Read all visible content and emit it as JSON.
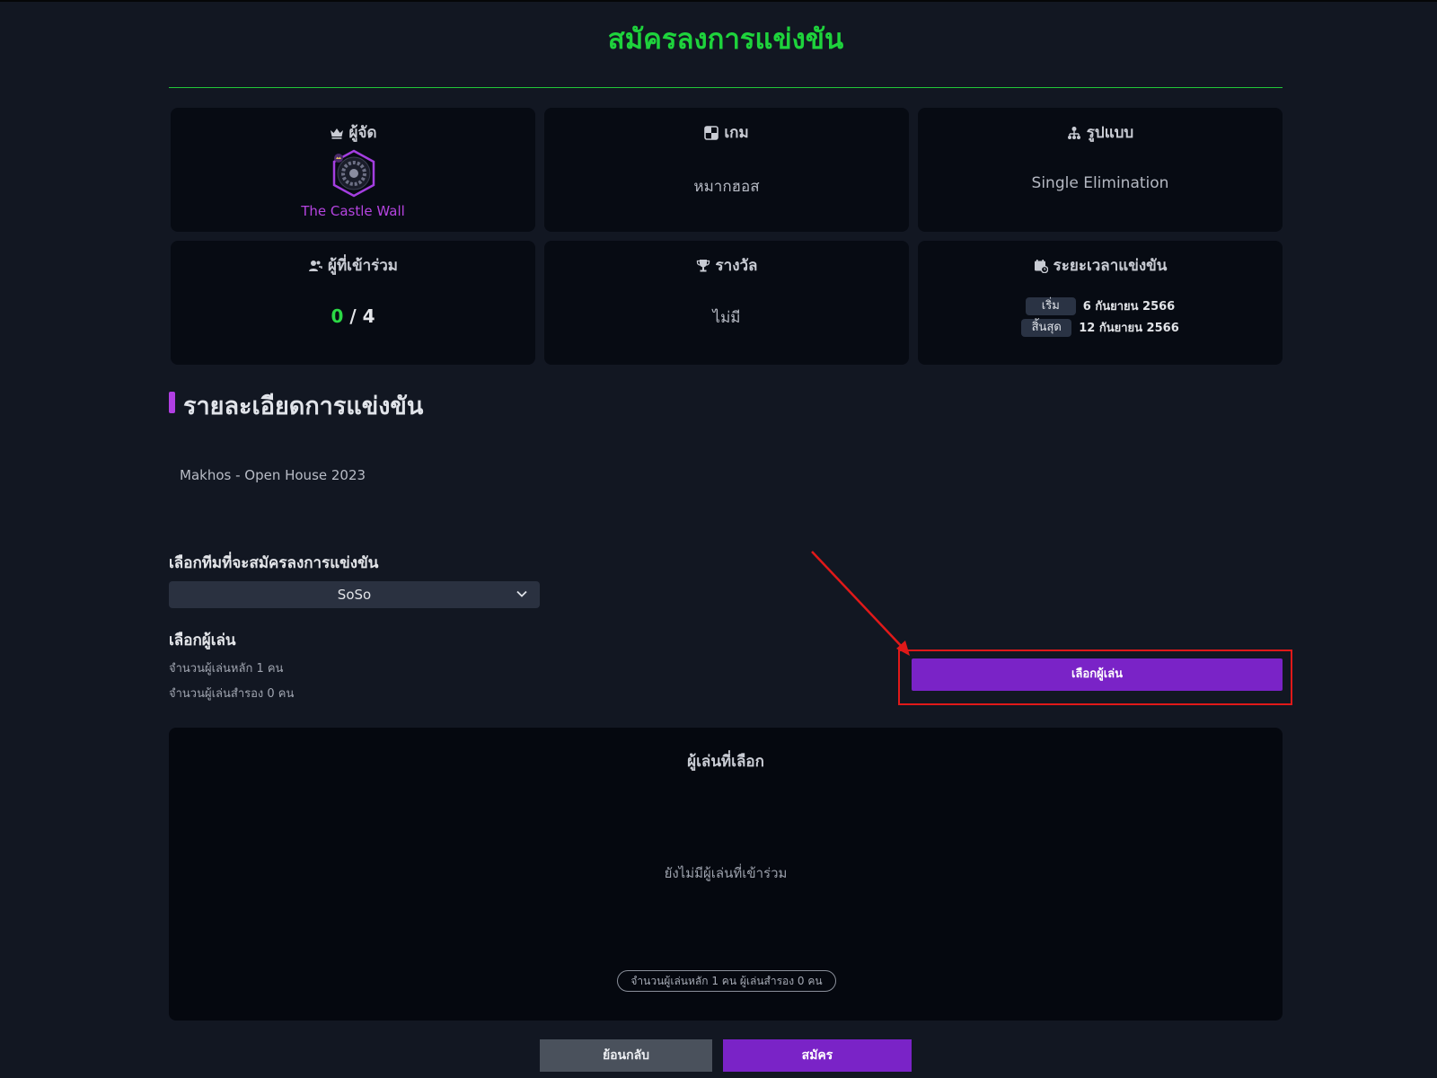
{
  "page": {
    "title": "สมัครลงการแข่งขัน"
  },
  "info_cards": {
    "organizer": {
      "label": "ผู้จัด",
      "name": "The Castle Wall"
    },
    "game": {
      "label": "เกม",
      "value": "หมากฮอส"
    },
    "format": {
      "label": "รูปแบบ",
      "value": "Single Elimination"
    },
    "participants": {
      "label": "ผู้ที่เข้าร่วม",
      "current": "0",
      "separator": " / ",
      "max": "4"
    },
    "prize": {
      "label": "รางวัล",
      "value": "ไม่มี"
    },
    "period": {
      "label": "ระยะเวลาแข่งขัน",
      "start_label": "เริ่ม",
      "start_date": "6 กันยายน 2566",
      "end_label": "สิ้นสุด",
      "end_date": "12 กันยายน 2566"
    }
  },
  "details": {
    "heading": "รายละเอียดการแข่งขัน",
    "description": "Makhos - Open House 2023"
  },
  "team_select": {
    "label": "เลือกทีมที่จะสมัครลงการแข่งขัน",
    "selected": "SoSo"
  },
  "players": {
    "label": "เลือกผู้เล่น",
    "main_count_text": "จำนวนผู้เล่นหลัก 1 คน",
    "sub_count_text": "จำนวนผู้เล่นสำรอง 0 คน",
    "pick_button": "เลือกผู้เล่น"
  },
  "selected_panel": {
    "title": "ผู้เล่นที่เลือก",
    "empty_text": "ยังไม่มีผู้เล่นที่เข้าร่วม",
    "summary_pill": "จำนวนผู้เล่นหลัก 1 คน ผู้เล่นสำรอง 0 คน"
  },
  "actions": {
    "back": "ย้อนกลับ",
    "submit": "สมัคร"
  },
  "colors": {
    "accent_green": "#1ed33c",
    "accent_purple": "#7a23c7",
    "highlight_red": "#e01919"
  }
}
